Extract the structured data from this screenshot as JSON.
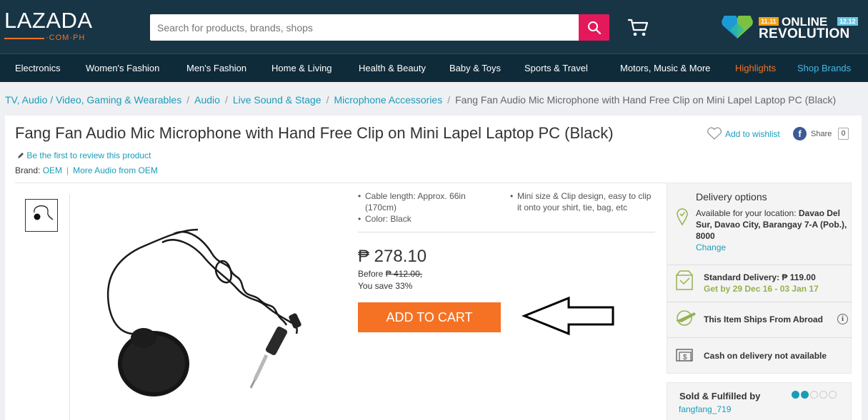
{
  "header": {
    "logo": "LAZADA",
    "logo_domain": "·COM·PH",
    "search_placeholder": "Search for products, brands, shops",
    "promo": {
      "tag_left": "11.11",
      "tag_right": "12.12",
      "line1": "ONLINE",
      "line2": "REVOLUTION"
    }
  },
  "nav": {
    "items": [
      "Electronics",
      "Women's Fashion",
      "Men's Fashion",
      "Home & Living",
      "Health & Beauty",
      "Baby & Toys",
      "Sports & Travel",
      "Motors, Music & More"
    ],
    "highlights": "Highlights",
    "shop_brands": "Shop Brands"
  },
  "breadcrumb": {
    "items": [
      "TV, Audio / Video, Gaming & Wearables",
      "Audio",
      "Live Sound & Stage",
      "Microphone Accessories"
    ],
    "current": "Fang Fan Audio Mic Microphone with Hand Free Clip on Mini Lapel Laptop PC (Black)",
    "separator": "/"
  },
  "product": {
    "title": "Fang Fan Audio Mic Microphone with Hand Free Clip on Mini Lapel Laptop PC (Black)",
    "wishlist": "Add to wishlist",
    "share": "Share",
    "share_count": "0",
    "review_link": "Be the first to review this product",
    "brand_label": "Brand:",
    "brand": "OEM",
    "more_from": "More Audio from OEM",
    "separator": "|",
    "features_left": [
      "Cable length: Approx. 66in (170cm)",
      "Color: Black"
    ],
    "features_right": [
      "Mini size & Clip design, easy to clip it onto your shirt, tie, bag, etc"
    ],
    "price": "₱ 278.10",
    "before_label": "Before",
    "before_price": "₱ 412.00,",
    "save_label": "You save",
    "save_value": "33%",
    "add_to_cart": "ADD TO CART"
  },
  "delivery": {
    "heading": "Delivery options",
    "location_label": "Available for your location:",
    "location": "Davao Del Sur, Davao City, Barangay 7-A (Pob.), 8000",
    "change": "Change",
    "standard": "Standard Delivery: ₱ 119.00",
    "standard_dates": "Get by 29 Dec 16 - 03 Jan 17",
    "ships_abroad": "This Item Ships From Abroad",
    "info_icon": "i",
    "cod": "Cash on delivery not available",
    "accent": "#95b24e"
  },
  "seller": {
    "label": "Sold & Fulfilled by",
    "name": "fangfang_719",
    "rating": 2,
    "rating_max": 5
  },
  "colors": {
    "header": "#183545",
    "nav": "#0f2b3a",
    "accent_orange": "#f57224",
    "link": "#1a9cb7",
    "search_button": "#e3195b"
  }
}
